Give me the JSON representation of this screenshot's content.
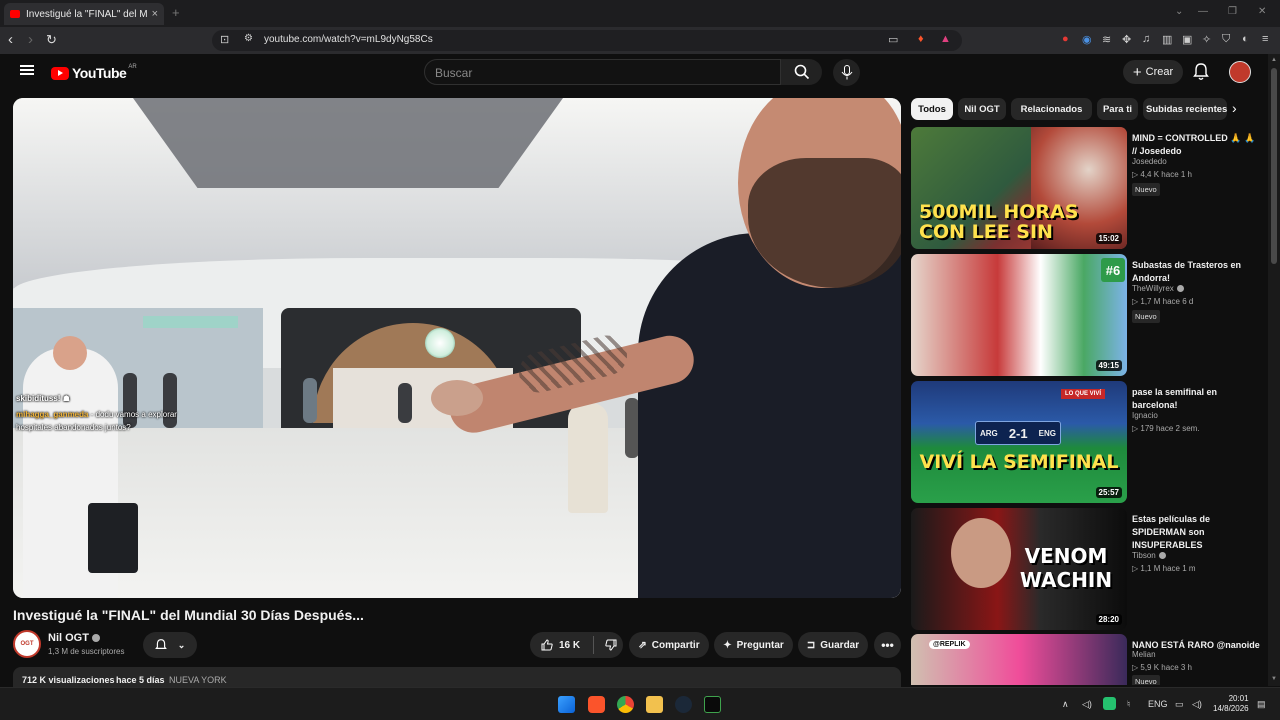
{
  "browser": {
    "tab_title": "Investigué la \"FINAL\" del Mundi",
    "tab_close": "×",
    "new_tab": "+",
    "url": "youtube.com/watch?v=mL9dyNg58Cs",
    "window_controls": [
      "⌄",
      "—",
      "❐",
      "✕"
    ]
  },
  "header": {
    "logo_text": "YouTube",
    "country_code": "AR",
    "search_placeholder": "Buscar",
    "create_label": "Crear"
  },
  "video": {
    "chat": [
      {
        "user": "skibidituss!",
        "text": ""
      },
      {
        "user": "mihagga_ganmeda",
        "text": "- dodu vamos a explorar"
      },
      {
        "user": "",
        "text": "hospitales abandonados juntos?"
      }
    ],
    "title": "Investigué la \"FINAL\" del Mundial 30 Días Después...",
    "channel": "Nil OGT",
    "subscribers": "1,3 M de suscriptores",
    "likes": "16 K",
    "share": "Compartir",
    "ask": "Preguntar",
    "save": "Guardar",
    "views": "712 K visualizaciones",
    "ago": "hace 5 días",
    "location": "NUEVA YORK"
  },
  "chips": [
    "Todos",
    "Nil OGT",
    "Relacionados",
    "Para ti",
    "Subidas recientes"
  ],
  "recommendations": [
    {
      "title": "MIND = CONTROLLED 🙏 🙏 // Josededo",
      "channel": "Josededo",
      "verified": false,
      "views": "4,4 K",
      "ago": "hace 1 h",
      "badge": "Nuevo",
      "duration": "15:02",
      "thumb_text": "500MIL HORAS CON LEE SIN"
    },
    {
      "title": "Subastas de Trasteros en Andorra!",
      "channel": "TheWillyrex",
      "verified": true,
      "views": "1,7 M",
      "ago": "hace 6 d",
      "badge": "Nuevo",
      "duration": "49:15",
      "thumb_text": "#6"
    },
    {
      "title": "pase la semifinal en barcelona!",
      "channel": "Ignacio",
      "verified": false,
      "views": "179",
      "ago": "hace 2 sem.",
      "badge": "",
      "duration": "25:57",
      "thumb_text": "VIVÍ LA SEMIFINAL",
      "score": "2-1",
      "home": "ARG",
      "away": "ENG",
      "tag": "LO QUE VIVÍ"
    },
    {
      "title": "Estas películas de SPIDERMAN son INSUPERABLES",
      "channel": "Tibson",
      "verified": true,
      "views": "1,1 M",
      "ago": "hace 1 m",
      "badge": "",
      "duration": "28:20",
      "thumb_text": "VENOM WACHIN"
    },
    {
      "title": "NANO ESTÁ RARO @nanoide",
      "channel": "Melian",
      "verified": false,
      "views": "5,9 K",
      "ago": "hace 3 h",
      "badge": "Nuevo",
      "duration": "",
      "thumb_text": "@REPLIK"
    }
  ],
  "taskbar": {
    "lang": "ENG",
    "time": "20:01",
    "date": "14/8/2026"
  }
}
